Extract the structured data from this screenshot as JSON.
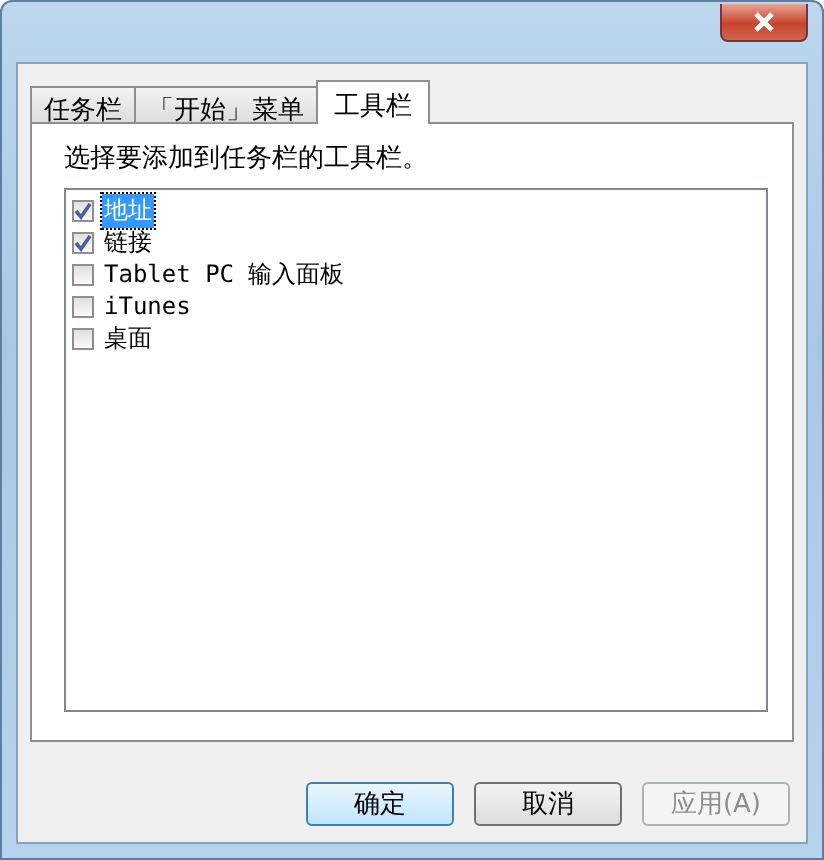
{
  "tabs": [
    {
      "label": "任务栏",
      "selected": false
    },
    {
      "label": "「开始」菜单",
      "selected": false
    },
    {
      "label": "工具栏",
      "selected": true
    }
  ],
  "instruction": "选择要添加到任务栏的工具栏。",
  "toolbars": [
    {
      "label": "地址",
      "checked": true,
      "selected": true
    },
    {
      "label": "链接",
      "checked": true,
      "selected": false
    },
    {
      "label": "Tablet PC 输入面板",
      "checked": false,
      "selected": false
    },
    {
      "label": "iTunes",
      "checked": false,
      "selected": false
    },
    {
      "label": "桌面",
      "checked": false,
      "selected": false
    }
  ],
  "buttons": [
    {
      "label": "确定",
      "disabled": false
    },
    {
      "label": "取消",
      "disabled": false
    },
    {
      "label": "应用(A)",
      "disabled": true
    }
  ]
}
